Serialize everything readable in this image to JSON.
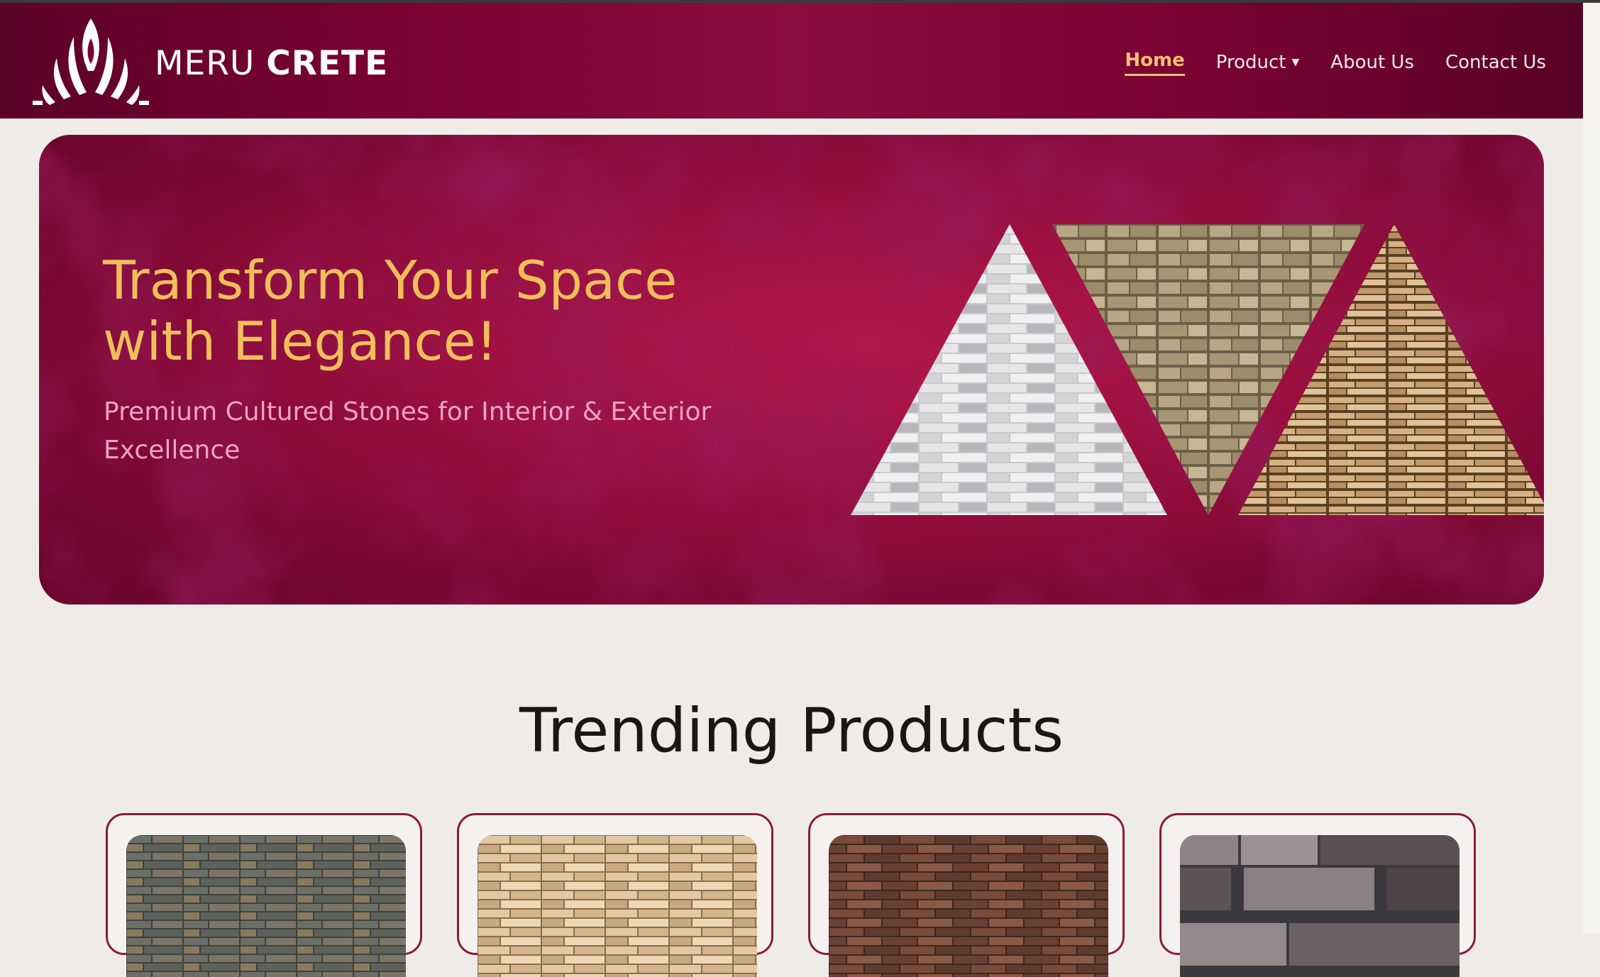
{
  "brand": {
    "name_light": "MERU",
    "name_bold": "CRETE"
  },
  "nav": {
    "items": [
      {
        "label": "Home",
        "active": true
      },
      {
        "label": "Product",
        "has_dropdown": true
      },
      {
        "label": "About Us"
      },
      {
        "label": "Contact Us"
      }
    ]
  },
  "hero": {
    "title": "Transform Your Space with Elegance!",
    "subtitle": "Premium Cultured Stones for Interior & Exterior Excellence"
  },
  "trending": {
    "title": "Trending Products",
    "cards": [
      {
        "image": "slate-stone-texture"
      },
      {
        "image": "beige-ledge-stone-texture"
      },
      {
        "image": "brown-brick-texture"
      },
      {
        "image": "grey-brick-texture"
      }
    ]
  },
  "colors": {
    "brand_maroon": "#7a0233",
    "accent_gold": "#f3c26f",
    "hero_crimson": "#9c1040",
    "subtitle_pink": "#efa2c2",
    "background": "#efece8"
  }
}
